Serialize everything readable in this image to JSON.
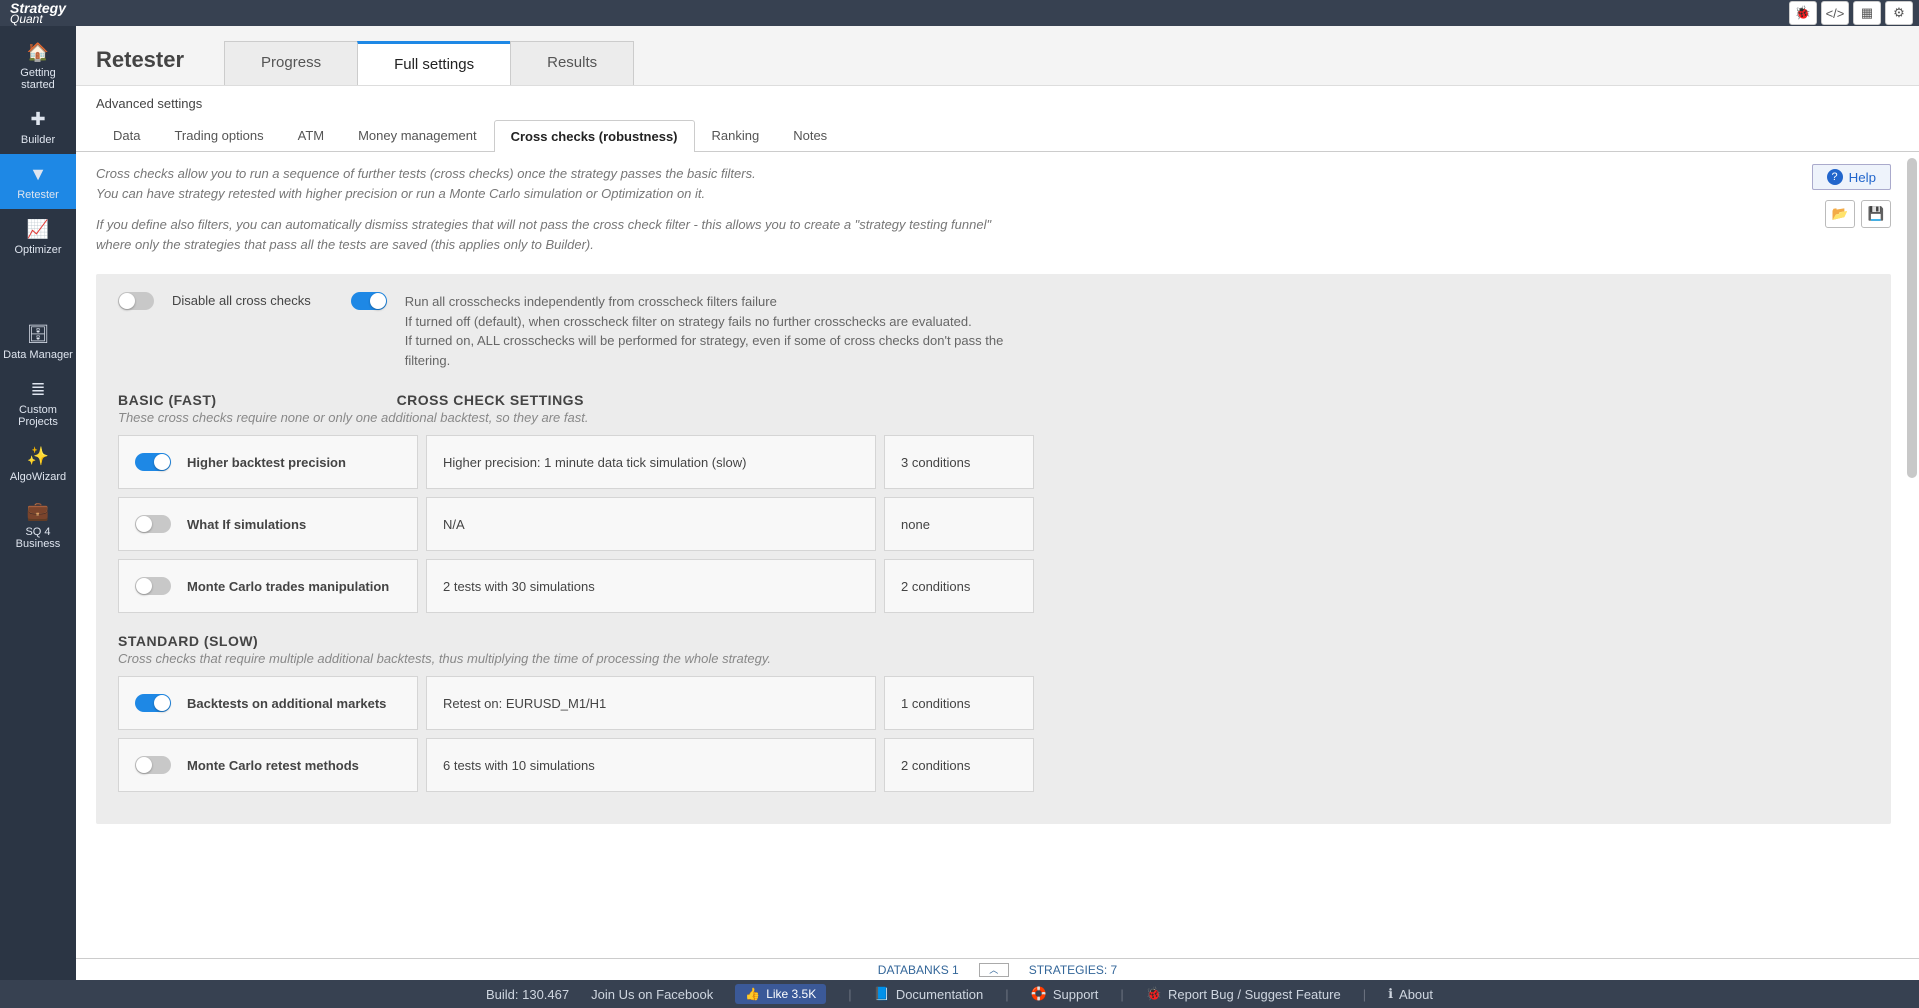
{
  "logo": {
    "line1": "Strategy",
    "line2": "Quant"
  },
  "topbar_icons": [
    "bug",
    "code",
    "grid",
    "settings"
  ],
  "sidebar": [
    {
      "id": "getting-started",
      "icon": "🏠",
      "label": "Getting started"
    },
    {
      "id": "builder",
      "icon": "➕",
      "label": "Builder"
    },
    {
      "id": "retester",
      "icon": "⧩",
      "label": "Retester",
      "active": true
    },
    {
      "id": "optimizer",
      "icon": "📈",
      "label": "Optimizer"
    },
    {
      "id": "data-manager",
      "icon": "🗄",
      "label": "Data Manager"
    },
    {
      "id": "custom-projects",
      "icon": "≣",
      "label": "Custom Projects"
    },
    {
      "id": "algowizard",
      "icon": "✨",
      "label": "AlgoWizard"
    },
    {
      "id": "sq4business",
      "icon": "💼",
      "label": "SQ 4 Business"
    }
  ],
  "page": {
    "title": "Retester",
    "tabs": [
      "Progress",
      "Full settings",
      "Results"
    ],
    "active_tab": "Full settings",
    "subtitle": "Advanced settings"
  },
  "sub_tabs": [
    "Data",
    "Trading options",
    "ATM",
    "Money management",
    "Cross checks (robustness)",
    "Ranking",
    "Notes"
  ],
  "active_sub_tab": "Cross checks (robustness)",
  "intro": {
    "p1": "Cross checks allow you to run a sequence of further tests (cross checks) once the strategy passes the basic filters.",
    "p2": "You can have strategy retested with higher precision or run a Monte Carlo simulation or Optimization on it.",
    "p3": "If you define also filters, you can automatically dismiss strategies that will not pass the cross check filter - this allows you to create a \"strategy testing funnel\" where only the strategies that pass all the tests are saved (this applies only to Builder)."
  },
  "help_label": "Help",
  "top_toggles": {
    "disable_label": "Disable all cross checks",
    "run_all_label": "Run all crosschecks independently from crosscheck filters failure",
    "run_all_desc1": "If turned off (default), when crosscheck filter on strategy fails no further crosschecks are evaluated.",
    "run_all_desc2": "If turned on, ALL crosschecks will be performed for strategy, even if some of cross checks don't pass the filtering."
  },
  "sections": [
    {
      "title": "BASIC (FAST)",
      "settings_label": "CROSS CHECK SETTINGS",
      "subtitle": "These cross checks require none or only one additional backtest, so they are fast.",
      "rows": [
        {
          "on": true,
          "name": "Higher backtest precision",
          "setting": "Higher precision: 1 minute data tick simulation (slow)",
          "cond": "3 conditions"
        },
        {
          "on": false,
          "name": "What If simulations",
          "setting": "N/A",
          "cond": "none"
        },
        {
          "on": false,
          "name": "Monte Carlo trades manipulation",
          "setting": "2 tests with 30 simulations",
          "cond": "2 conditions"
        }
      ]
    },
    {
      "title": "STANDARD (SLOW)",
      "subtitle": "Cross checks that require multiple additional backtests, thus multiplying the time of processing the whole strategy.",
      "rows": [
        {
          "on": true,
          "name": "Backtests on additional markets",
          "setting": "Retest on: EURUSD_M1/H1",
          "cond": "1 conditions"
        },
        {
          "on": false,
          "name": "Monte Carlo retest methods",
          "setting": "6 tests with 10 simulations",
          "cond": "2 conditions"
        }
      ]
    }
  ],
  "footer": {
    "databanks_label": "DATABANKS 1",
    "strategies_label": "STRATEGIES: 7"
  },
  "bottombar": {
    "build": "Build: 130.467",
    "join": "Join Us on Facebook",
    "like": "Like 3.5K",
    "doc": "Documentation",
    "support": "Support",
    "report": "Report Bug / Suggest Feature",
    "about": "About"
  }
}
